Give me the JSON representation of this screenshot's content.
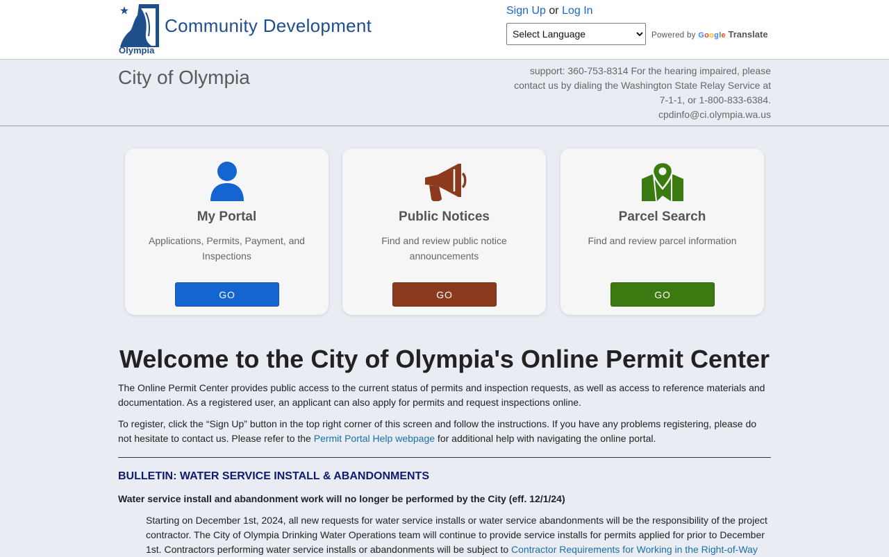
{
  "header": {
    "brand_title": "Community Development",
    "logo_text": "Olympia",
    "signup_label": "Sign Up",
    "or_text": "or",
    "login_label": "Log In",
    "language_selected": "Select Language",
    "powered_by": "Powered by",
    "google_word": "Google",
    "translate_word": "Translate"
  },
  "info": {
    "city_title": "City of Olympia",
    "support_line1": "support: 360-753-8314 For the hearing impaired, please",
    "support_line2": "contact us by dialing the Washington State Relay Service at",
    "support_line3": "7-1-1, or 1-800-833-6384.",
    "email": "cpdinfo@ci.olympia.wa.us"
  },
  "cards": [
    {
      "title": "My Portal",
      "description": "Applications, Permits, Payment, and Inspections",
      "button": "GO",
      "icon": "user-icon",
      "color": "#1565d0"
    },
    {
      "title": "Public Notices",
      "description": "Find and review public notice announcements",
      "button": "GO",
      "icon": "megaphone-icon",
      "color": "#8b3a1e"
    },
    {
      "title": "Parcel Search",
      "description": "Find and review parcel information",
      "button": "GO",
      "icon": "map-pin-icon",
      "color": "#3a7a10"
    }
  ],
  "main": {
    "welcome_title": "Welcome to the City of Olympia's Online Permit Center",
    "intro_paragraph": "The Online Permit Center provides public access to the current status of permits and inspection requests, as well as access to reference materials and documentation. As a registered user, an applicant can also apply for permits and request inspections online.",
    "register_text_before": "To register, click the “Sign Up” button in the top right corner of this screen and follow the instructions. If you have any problems registering, please do not hesitate to contact us. Please refer to the ",
    "help_link": "Permit Portal Help webpage",
    "register_text_after": " for additional help with navigating the online portal."
  },
  "bulletin": {
    "heading": "BULLETIN: WATER SERVICE INSTALL & ABANDONMENTS",
    "subheading": "Water service install and abandonment work will no longer be performed by the City (eff. 12/1/24)",
    "body_text": "Starting on December 1st, 2024, all new requests for water service installs or water service abandonments will be the responsibility of the project contractor. The City of Olympia Drinking Water Operations team will continue to provide service installs for permits applied for prior to December 1st. Contractors performing water service installs or abandonments will be subject to ",
    "body_link": "Contractor Requirements for Working in the Right-of-Way"
  },
  "colors": {
    "brand_blue": "#1f4e8c",
    "link_blue": "#1a66c9",
    "page_bg": "#e9ecf3",
    "bulletin_navy": "#101a6e"
  }
}
